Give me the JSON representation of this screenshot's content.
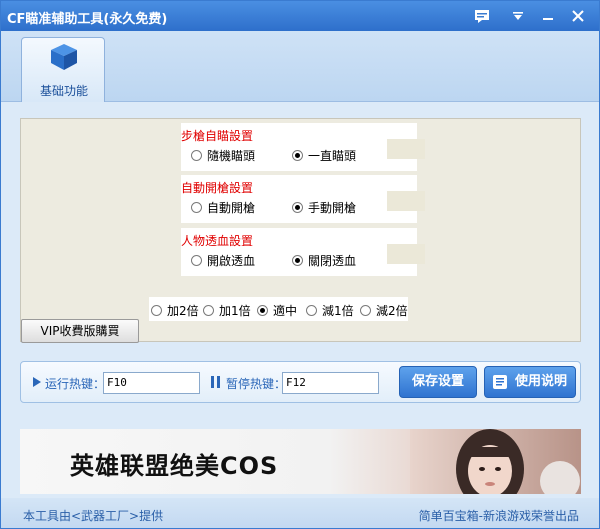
{
  "window": {
    "title": "CF瞄准辅助工具(永久免费)"
  },
  "tab": {
    "label": "基础功能"
  },
  "rifle_group": {
    "title": "步槍自瞄設置",
    "opt1": "隨機瞄頭",
    "opt2": "一直瞄頭",
    "selected": 2
  },
  "autofire_group": {
    "title": "自動開槍設置",
    "opt1": "自動開槍",
    "opt2": "手動開槍",
    "selected": 2
  },
  "health_group": {
    "title": "人物透血設置",
    "opt1": "開啟透血",
    "opt2": "關閉透血",
    "selected": 2
  },
  "speed": {
    "options": [
      "加2倍",
      "加1倍",
      "適中",
      "減1倍",
      "減2倍"
    ],
    "selected": 2
  },
  "vip_button": "VIP收費版購買",
  "hotkeys": {
    "run_label": "运行热键：",
    "run_value": "F10",
    "pause_label": "暂停热键：",
    "pause_value": "F12"
  },
  "buttons": {
    "save": "保存设置",
    "help": "使用说明"
  },
  "banner": {
    "text": "英雄联盟绝美COS"
  },
  "footer": {
    "left": "本工具由<武器工厂>提供",
    "right": "简单百宝箱-新浪游戏荣誉出品"
  },
  "colors": {
    "title_bar": "#2e6fcb",
    "group_title": "#e00000",
    "accent": "#2f73d0"
  }
}
